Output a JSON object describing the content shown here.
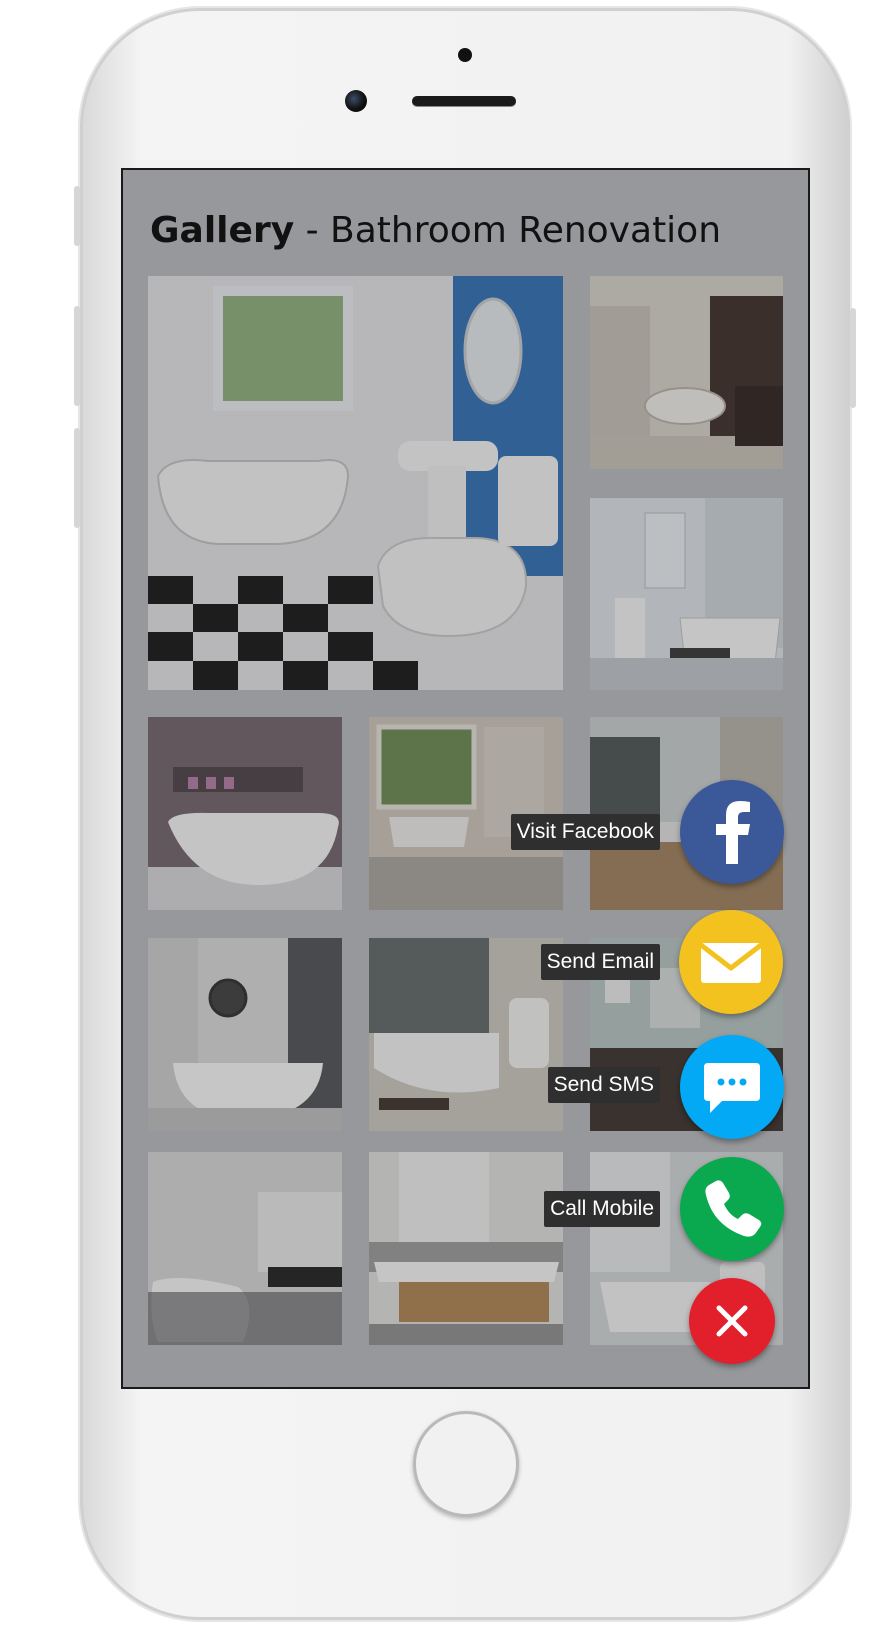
{
  "gallery": {
    "title_bold": "Gallery",
    "title_rest": " - Bathroom Renovation",
    "images": [
      "bathroom-photo-1",
      "bathroom-photo-2",
      "bathroom-photo-3",
      "bathroom-photo-4",
      "bathroom-photo-5",
      "bathroom-photo-6",
      "bathroom-photo-7",
      "bathroom-photo-8",
      "bathroom-photo-9",
      "bathroom-photo-10",
      "bathroom-photo-11",
      "bathroom-photo-12"
    ]
  },
  "contact_menu": {
    "facebook_label": "Visit Facebook",
    "email_label": "Send Email",
    "sms_label": "Send SMS",
    "call_label": "Call Mobile",
    "colors": {
      "facebook": "#3b5998",
      "email": "#f4c21f",
      "sms": "#03a9f4",
      "call": "#0aa84f",
      "close": "#e2202b"
    },
    "icons": [
      "facebook-icon",
      "email-icon",
      "chat-icon",
      "phone-icon",
      "close-icon"
    ]
  }
}
